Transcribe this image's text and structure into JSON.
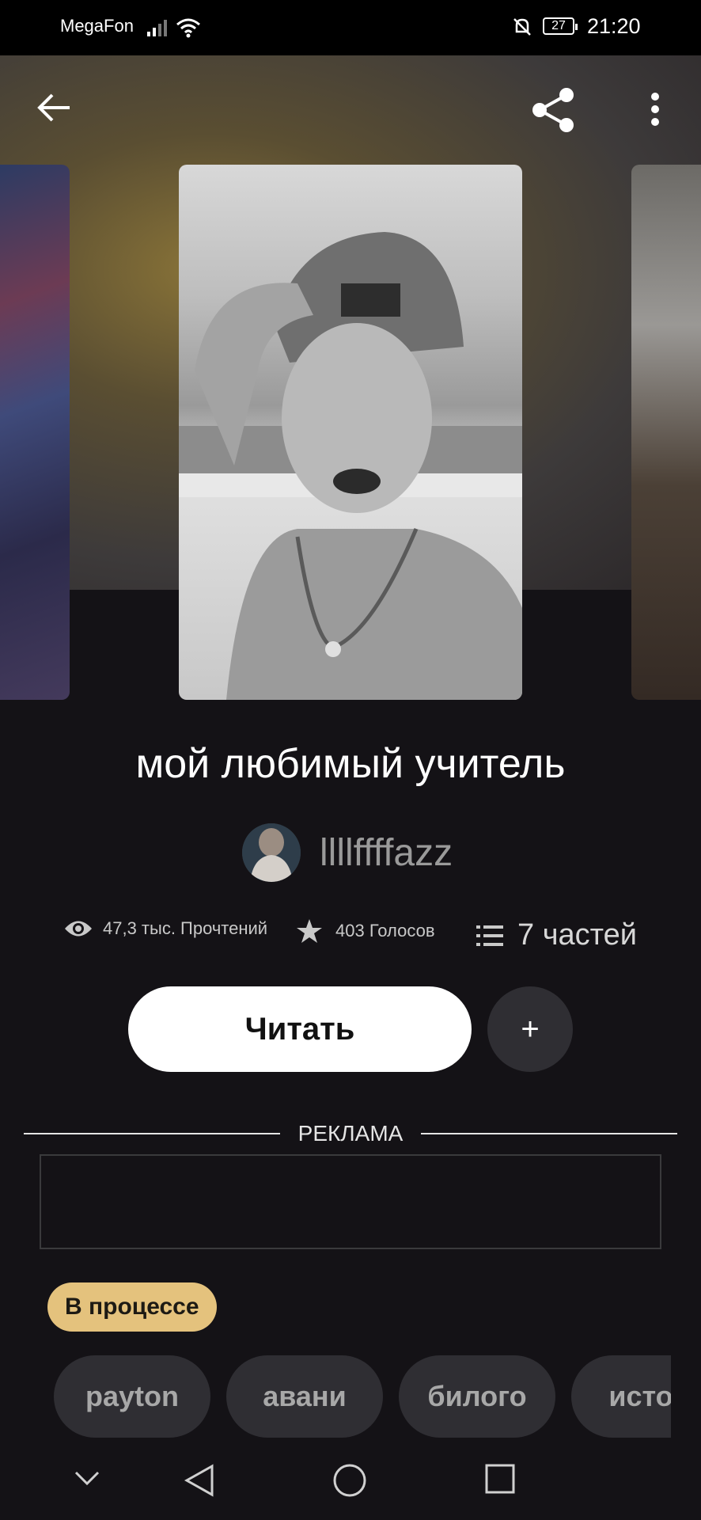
{
  "status_bar": {
    "carrier": "MegaFon",
    "battery": "27",
    "time": "21:20"
  },
  "top_bar": {
    "back_icon": "arrow-left",
    "share_icon": "share",
    "more_icon": "more-vertical"
  },
  "story": {
    "title": "мой любимый учитель",
    "author": "llllffffazz",
    "reads": "47,3 тыс. Прочтений",
    "votes": "403 Голосов",
    "parts": "7 частей",
    "status": "В процессе"
  },
  "actions": {
    "read_label": "Читать",
    "add_label": "+"
  },
  "ad": {
    "label": "РЕКЛАМА"
  },
  "tags": [
    "payton",
    "авани",
    "билого",
    "истор"
  ],
  "colors": {
    "background": "#141216",
    "badge": "#e4c27d",
    "chip": "#2f2e33"
  }
}
